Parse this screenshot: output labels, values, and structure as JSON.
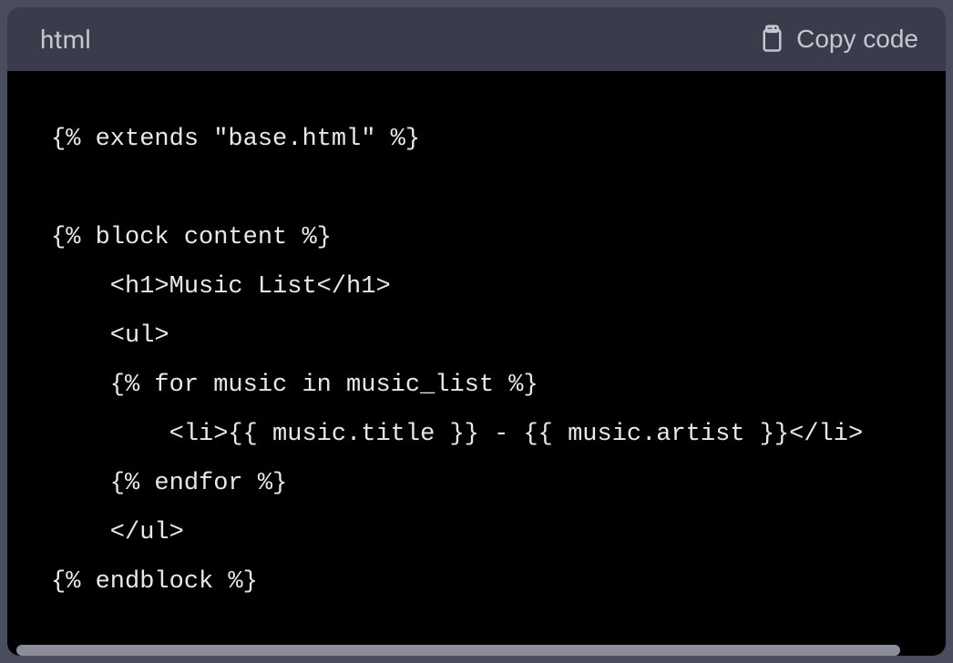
{
  "header": {
    "language_label": "html",
    "copy_label": "Copy code"
  },
  "code": {
    "lines": [
      "{% extends \"base.html\" %}",
      "",
      "{% block content %}",
      "    <h1>Music List</h1>",
      "    <ul>",
      "    {% for music in music_list %}",
      "        <li>{{ music.title }} - {{ music.artist }}</li>",
      "    {% endfor %}",
      "    </ul>",
      "{% endblock %}"
    ]
  }
}
